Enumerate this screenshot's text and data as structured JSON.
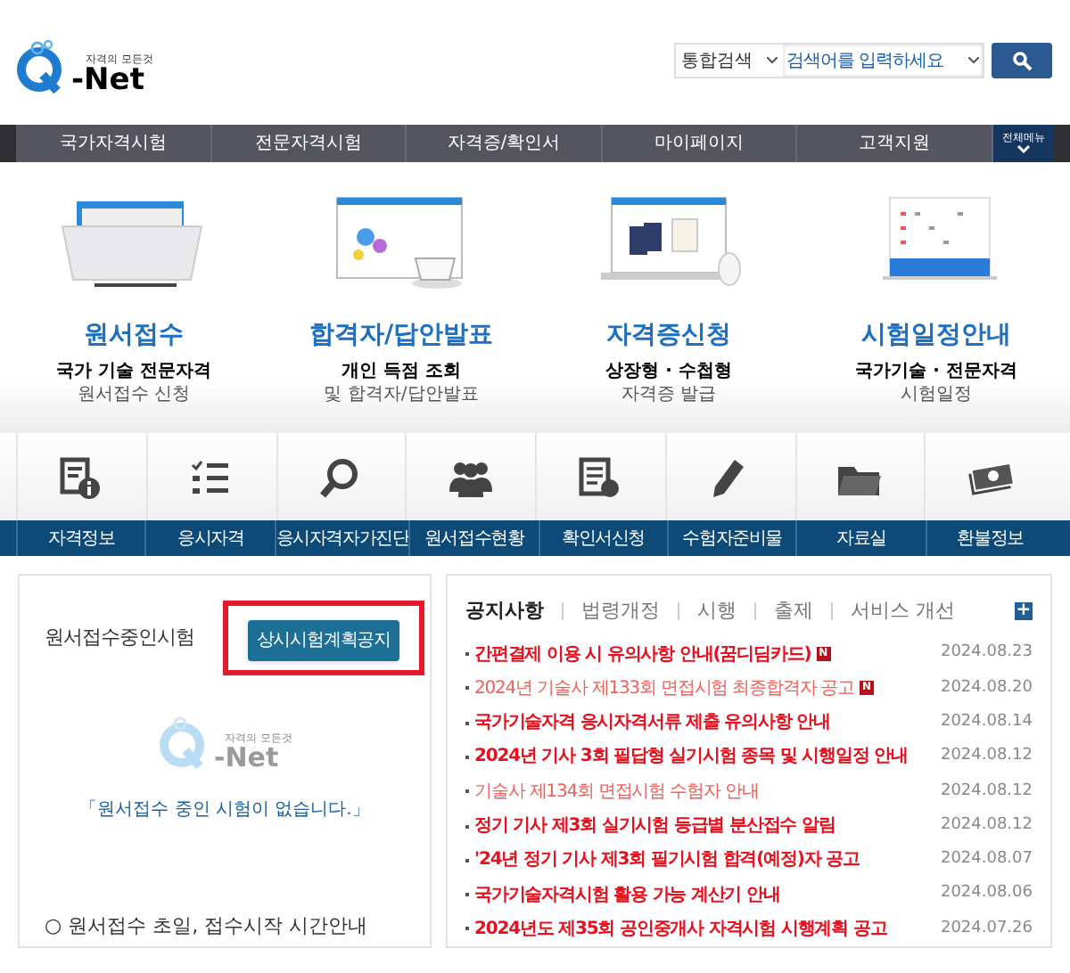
{
  "logo": {
    "tagline": "자격의 모든것",
    "wordmark": "-Net"
  },
  "search": {
    "scope": "통합검색",
    "placeholder": "검색어를 입력하세요"
  },
  "nav": {
    "items": [
      "국가자격시험",
      "전문자격시험",
      "자격증/확인서",
      "마이페이지",
      "고객지원"
    ],
    "all_menu": "전체메뉴"
  },
  "features": [
    {
      "kind": "folder",
      "title": "원서접수",
      "line1": "국가 기술 전문자격",
      "line2": "원서접수 신청"
    },
    {
      "kind": "browser",
      "title": "합격자/답안발표",
      "line1": "개인 득점 조회",
      "line2": "및 합격자/답안발표"
    },
    {
      "kind": "laptop",
      "title": "자격증신청",
      "line1": "상장형 · 수첩형",
      "line2": "자격증 발급"
    },
    {
      "kind": "calendar",
      "title": "시험일정안내",
      "line1": "국가기술 · 전문자격",
      "line2": "시험일정"
    }
  ],
  "quick_links": [
    {
      "kind": "info",
      "label": "자격정보"
    },
    {
      "kind": "list",
      "label": "응시자격"
    },
    {
      "kind": "search",
      "label": "응시자격자가진단"
    },
    {
      "kind": "people",
      "label": "원서접수현황"
    },
    {
      "kind": "doc",
      "label": "확인서신청"
    },
    {
      "kind": "pencil",
      "label": "수험자준비물"
    },
    {
      "kind": "folder",
      "label": "자료실"
    },
    {
      "kind": "money",
      "label": "환불정보"
    }
  ],
  "exam_panel": {
    "title": "원서접수중인시험",
    "button": "상시시험계획공지",
    "button_highlighted": true,
    "watermark": {
      "wordmark": "-Net",
      "tagline": "자격의 모든것"
    },
    "empty_message": "「원서접수 중인 시험이 없습니다.」",
    "guide": "○ 원서접수 초일, 접수시작 시간안내"
  },
  "notice_panel": {
    "tabs": [
      {
        "label": "공지사항",
        "selected": true
      },
      {
        "label": "법령개정",
        "selected": false
      },
      {
        "label": "시행",
        "selected": false
      },
      {
        "label": "출제",
        "selected": false
      },
      {
        "label": "서비스 개선",
        "selected": false
      }
    ],
    "more": "+",
    "items": [
      {
        "title": "간편결제 이용 시 유의사항 안내(꿈디딤카드)",
        "date": "2024.08.23",
        "bold": true,
        "badge": "N"
      },
      {
        "title": "2024년 기술사 제133회 면접시험 최종합격자 공고",
        "date": "2024.08.20",
        "bold": false,
        "badge": "N"
      },
      {
        "title": "국가기술자격 응시자격서류 제출 유의사항 안내",
        "date": "2024.08.14",
        "bold": true
      },
      {
        "title": "2024년 기사 3회 필답형 실기시험 종목 및 시행일정 안내",
        "date": "2024.08.12",
        "bold": true
      },
      {
        "title": "기술사 제134회 면접시험 수험자 안내",
        "date": "2024.08.12",
        "bold": false
      },
      {
        "title": "정기 기사 제3회 실기시험 등급별 분산접수 알림",
        "date": "2024.08.12",
        "bold": true
      },
      {
        "title": "'24년 정기 기사 제3회 필기시험 합격(예정)자 공고",
        "date": "2024.08.07",
        "bold": true
      },
      {
        "title": "국가기술자격시험 활용 가능 계산기 안내",
        "date": "2024.08.06",
        "bold": true
      },
      {
        "title": "2024년도 제35회 공인중개사 자격시험 시행계획 공고",
        "date": "2024.07.26",
        "bold": true
      }
    ]
  }
}
